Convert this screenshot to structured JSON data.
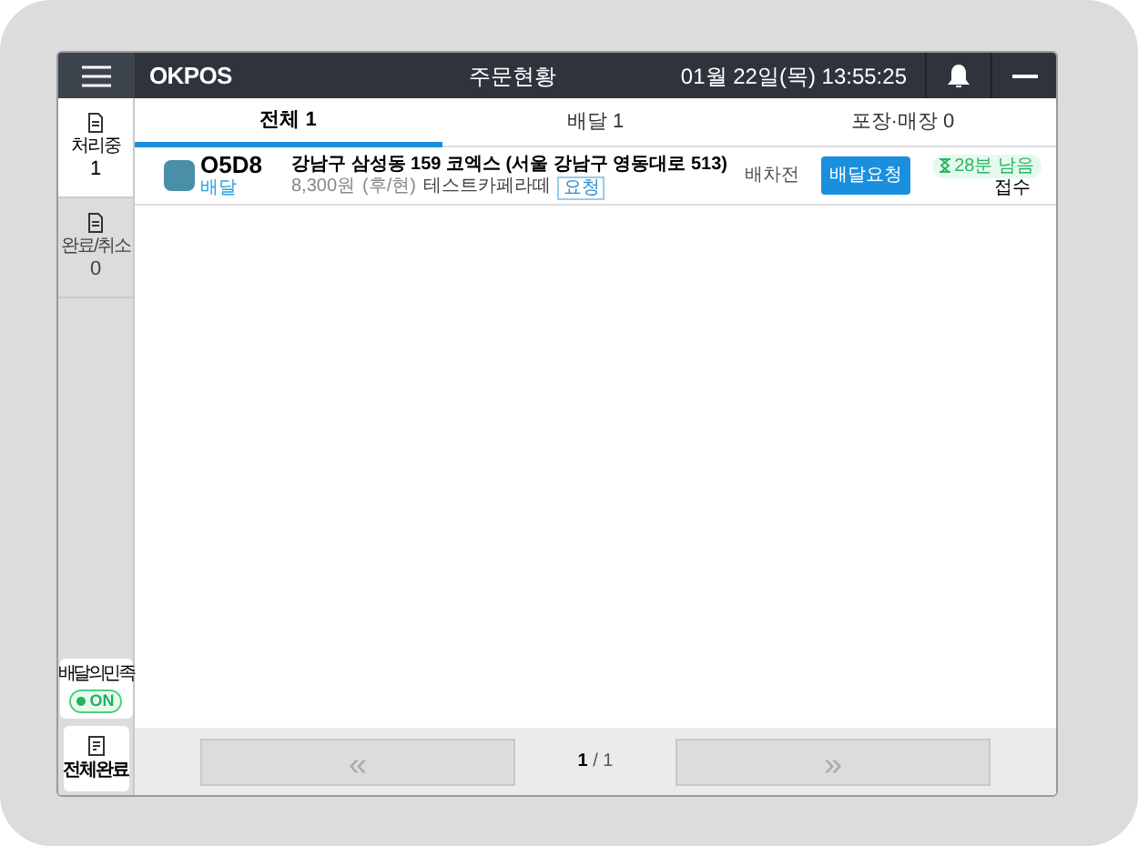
{
  "header": {
    "logo": "OKPOS",
    "title": "주문현황",
    "datetime": "01월 22일(목) 13:55:25"
  },
  "sidebar": {
    "items": [
      {
        "label": "처리중",
        "count": "1",
        "selected": true
      },
      {
        "label": "완료/취소",
        "count": "0",
        "selected": false
      }
    ],
    "delivery_toggle": {
      "label": "배달의민족",
      "state_text": "ON",
      "on": true
    },
    "complete_all": "전체완료"
  },
  "tabs": [
    {
      "label": "전체 1",
      "selected": true
    },
    {
      "label": "배달 1",
      "selected": false
    },
    {
      "label": "포장·매장 0",
      "selected": false
    }
  ],
  "orders": [
    {
      "code": "O5D8",
      "type": "배달",
      "address": "강남구 삼성동 159 코엑스 (서울 강남구 영동대로 513)",
      "price": "8,300원",
      "payment": "(후/현)",
      "store": "테스트카페라떼",
      "tag": "요청",
      "status": "배차전",
      "action": "배달요청",
      "timer": "28분 남음",
      "note": "접수"
    }
  ],
  "pager": {
    "current": "1",
    "total": "/ 1",
    "prev": "«",
    "next": "»"
  }
}
